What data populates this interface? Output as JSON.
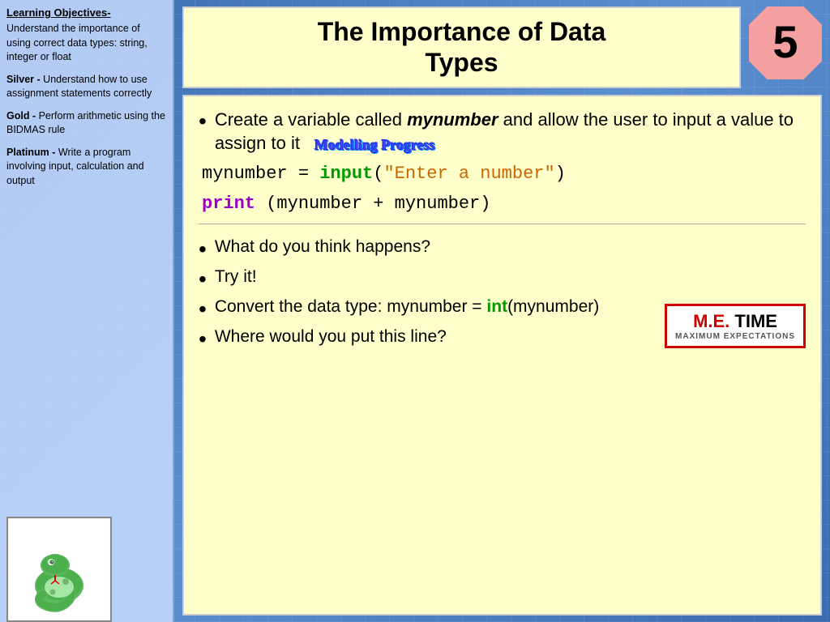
{
  "sidebar": {
    "title": "Learning Objectives-",
    "objective_main": "Understand the importance of using correct data types: string, integer or float",
    "silver_label": "Silver -",
    "silver_text": "Understand how to use assignment statements correctly",
    "gold_label": "Gold -",
    "gold_text": "Perform arithmetic using the BIDMAS rule",
    "platinum_label": "Platinum -",
    "platinum_text": "Write a program involving input, calculation and output"
  },
  "header": {
    "title_line1": "The Importance of Data",
    "title_line2": "Types",
    "slide_number": "5"
  },
  "content": {
    "bullet1_prefix": "Create a variable called ",
    "bullet1_italic": "mynumber",
    "bullet1_suffix": " and allow the user to input a value to assign to it",
    "modelling_progress": "Modelling Progress",
    "code_line1_var": "mynumber",
    "code_line1_eq": " = ",
    "code_line1_fn": "input",
    "code_line1_str": "\"Enter a number\"",
    "code_line2_kw": "print",
    "code_line2_body": "(mynumber + mynumber)",
    "bullet2": "What do you think happens?",
    "bullet3": "Try it!",
    "bullet4_prefix": "Convert the data type: mynumber = ",
    "bullet4_fn": "int",
    "bullet4_suffix": "(mynumber)",
    "bullet5": "Where would you put this line?",
    "me_time_line1_me": "M.E.",
    "me_time_line1_time": " TIME",
    "me_time_sub": "MAXIMUM EXPECTATIONS"
  }
}
